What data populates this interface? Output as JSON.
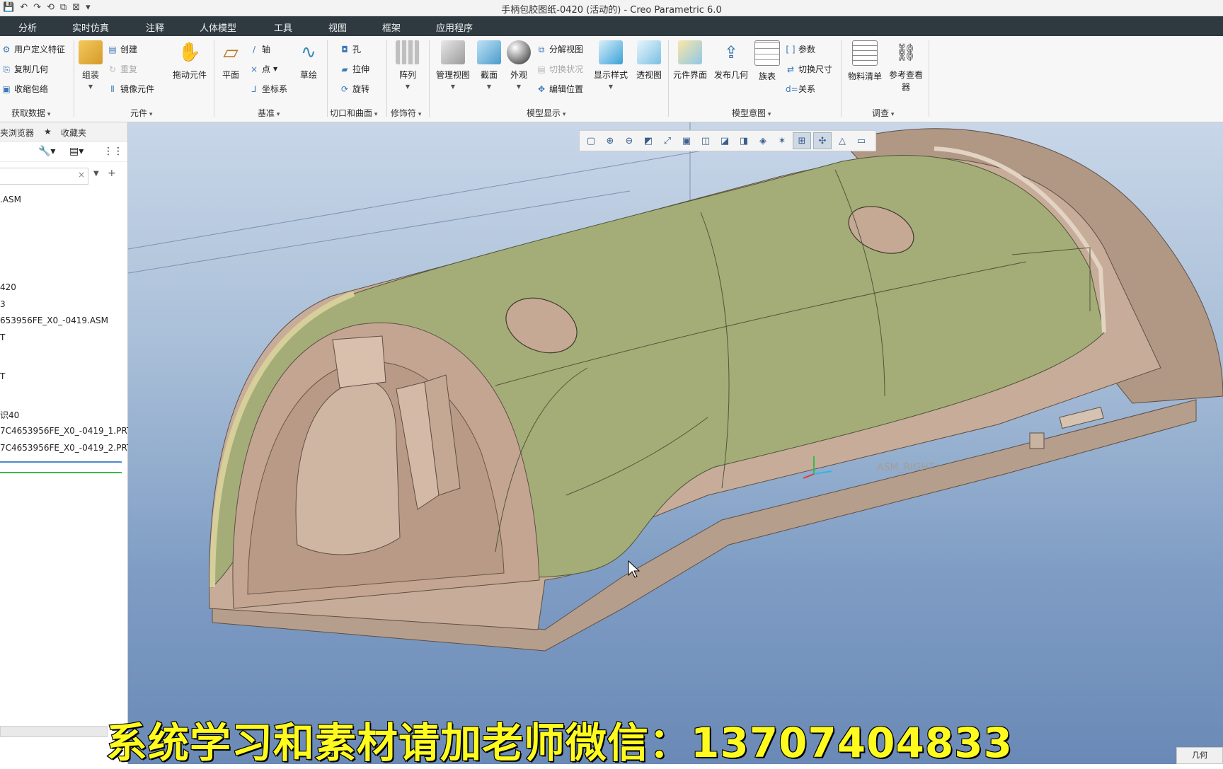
{
  "window": {
    "title": "手柄包胶图纸-0420 (活动的) - Creo Parametric 6.0",
    "qat_icons": [
      "save-icon",
      "undo-icon",
      "redo-icon",
      "regenerate-icon",
      "window-icon",
      "close-window-icon",
      "customize-icon"
    ]
  },
  "menu_tabs": [
    "分析",
    "实时仿真",
    "注释",
    "人体模型",
    "工具",
    "视图",
    "框架",
    "应用程序"
  ],
  "ribbon": {
    "get_data": {
      "items": [
        "用户定义特征",
        "复制几何",
        "收缩包络"
      ],
      "label": "获取数据"
    },
    "component": {
      "assemble": "组装",
      "create": "创建",
      "repeat": "重复",
      "mirror": "镜像元件",
      "drag": "拖动元件",
      "label": "元件"
    },
    "datum": {
      "plane": "平面",
      "axis": "轴",
      "point": "点",
      "csys": "坐标系",
      "sketch": "草绘",
      "label": "基准"
    },
    "cut_surface": {
      "hole": "孔",
      "extrude": "拉伸",
      "revolve": "旋转",
      "label": "切口和曲面"
    },
    "modifiers": {
      "pattern": "阵列",
      "label": "修饰符"
    },
    "model_display": {
      "manage_views": "管理视图",
      "section": "截面",
      "appearance": "外观",
      "explode_view": "分解视图",
      "toggle_status": "切换状况",
      "edit_position": "编辑位置",
      "display_style": "显示样式",
      "perspective": "透视图",
      "label": "模型显示"
    },
    "model_intent": {
      "component_interface": "元件界面",
      "publish_geometry": "发布几何",
      "family_table": "族表",
      "parameters": "参数",
      "switch_dimensions": "切换尺寸",
      "relations": "关系",
      "label": "模型意图"
    },
    "investigate": {
      "bom": "物料清单",
      "reference_viewer": "参考查看器",
      "label": "调查"
    }
  },
  "navigator": {
    "tabs": [
      "夹浏览器",
      "收藏夹"
    ],
    "tree_items": [
      ".ASM",
      "420",
      "3",
      "653956FE_X0_-0419.ASM",
      "T",
      "T",
      "识40",
      "7C4653956FE_X0_-0419_1.PRT",
      "7C4653956FE_X0_-0419_2.PRT"
    ]
  },
  "viewport": {
    "datum_label": "ASM_RIGHT",
    "view_toolbar_icons": [
      "refit-icon",
      "zoom-in-icon",
      "zoom-out-icon",
      "repaint-icon",
      "spin-center-icon",
      "view-normal-icon",
      "saved-views-icon",
      "display-style-icon",
      "view-manager-icon",
      "perspective-icon",
      "datum-display-icon",
      "annotation-display-icon",
      "csys-display-icon",
      "point-display-icon",
      "spin-icon",
      "render-icon"
    ]
  },
  "caption": "系统学习和素材请加老师微信：13707404833",
  "status": {
    "filter": "几何"
  },
  "colors": {
    "tab_bar": "#2f3a40",
    "model_top": "#a4ad78",
    "model_body": "#c6ab98",
    "caption": "#fffb1f"
  }
}
